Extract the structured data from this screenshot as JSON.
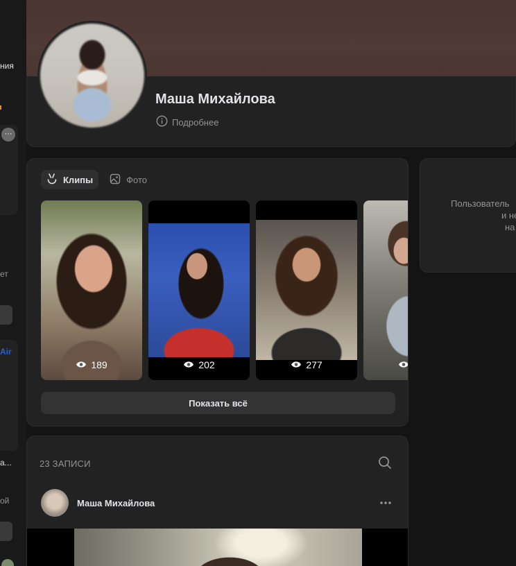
{
  "sidebar": {
    "fragments": [
      "ния",
      "ет",
      "ой",
      "а..."
    ],
    "thumb_labels": [
      "Air"
    ]
  },
  "profile": {
    "name": "Маша Михайлова",
    "more_label": "Подробнее"
  },
  "media": {
    "tabs": [
      {
        "label": "Клипы",
        "icon": "clips-icon",
        "active": true
      },
      {
        "label": "Фото",
        "icon": "photo-icon",
        "active": false
      }
    ],
    "clips": [
      {
        "views": "189"
      },
      {
        "views": "202"
      },
      {
        "views": "277"
      },
      {
        "views": ""
      }
    ],
    "show_all_label": "Показать всё"
  },
  "right_card": {
    "lines": [
      "Пользователь",
      "и не",
      "на"
    ]
  },
  "posts": {
    "count_label": "23 ЗАПИСИ",
    "author_name": "Маша Михайлова"
  },
  "colors": {
    "background": "#141414",
    "card": "#222222",
    "cover": "#4f3a36",
    "text_primary": "#e1e3e6",
    "text_secondary": "#939393"
  }
}
